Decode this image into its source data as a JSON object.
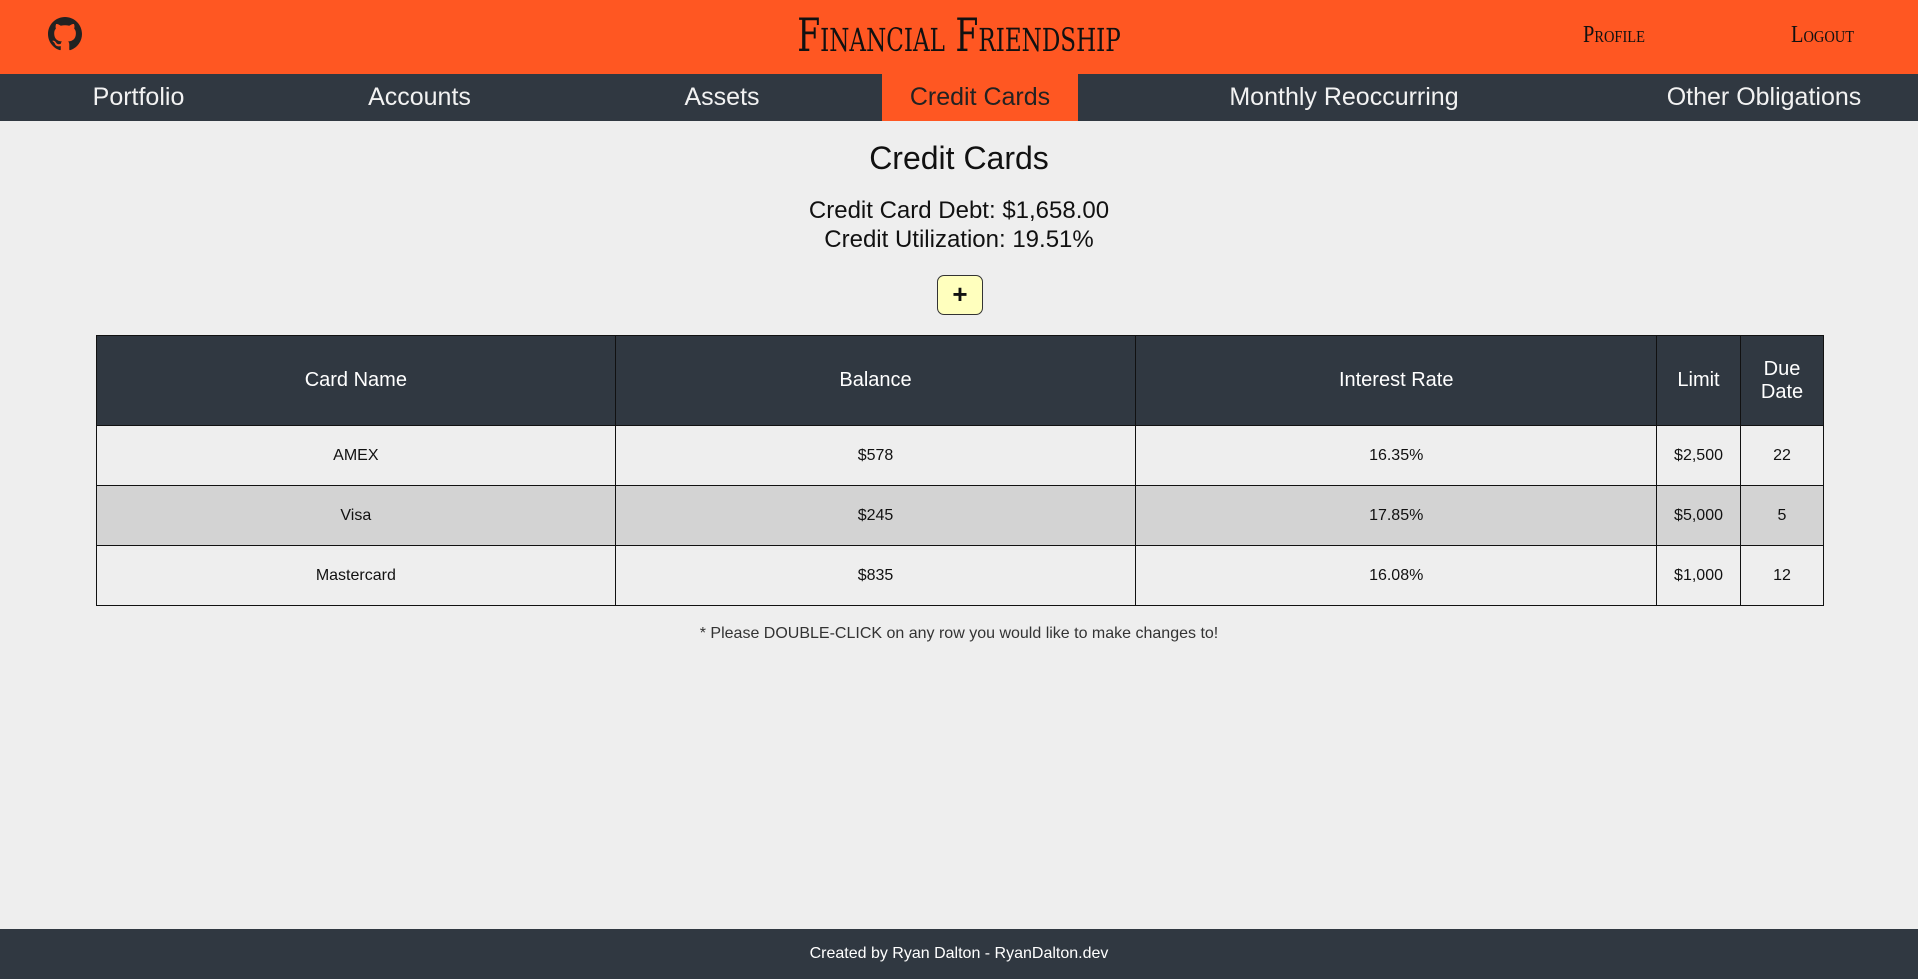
{
  "header": {
    "brand": "Financial Friendship",
    "github_icon": "github-icon",
    "profile_label": "Profile",
    "logout_label": "Logout",
    "color": "#ff5722"
  },
  "nav": {
    "items": [
      {
        "label": "Portfolio",
        "active": false
      },
      {
        "label": "Accounts",
        "active": false
      },
      {
        "label": "Assets",
        "active": false
      },
      {
        "label": "Credit Cards",
        "active": true
      },
      {
        "label": "Monthly Reoccurring",
        "active": false
      },
      {
        "label": "Other Obligations",
        "active": false
      }
    ],
    "color": "#303841"
  },
  "main": {
    "title": "Credit Cards",
    "debt_text": "Credit Card Debt: $1,658.00",
    "utilization_text": "Credit Utilization: 19.51%",
    "add_button_label": "+",
    "table": {
      "headers": [
        "Card Name",
        "Balance",
        "Interest Rate",
        "Limit",
        "Due Date"
      ],
      "rows": [
        [
          "AMEX",
          "$578",
          "16.35%",
          "$2,500",
          "22"
        ],
        [
          "Visa",
          "$245",
          "17.85%",
          "$5,000",
          "5"
        ],
        [
          "Mastercard",
          "$835",
          "16.08%",
          "$1,000",
          "12"
        ]
      ]
    },
    "note": "* Please DOUBLE-CLICK on any row you would like to make changes to!"
  },
  "footer": {
    "text": "Created by Ryan Dalton - RyanDalton.dev"
  }
}
